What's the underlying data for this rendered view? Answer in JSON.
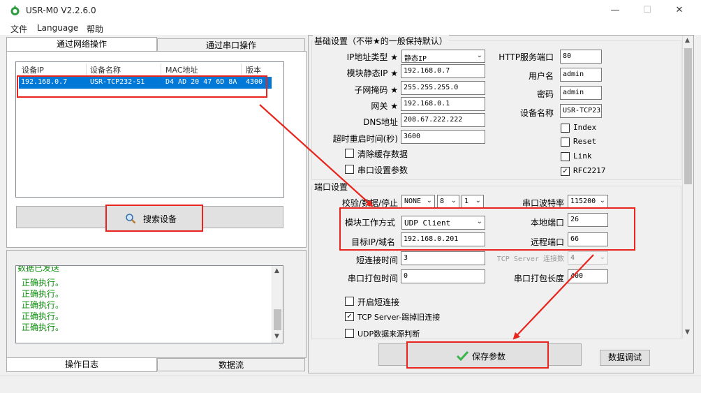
{
  "window": {
    "title": "USR-M0 V2.2.6.0",
    "minimize": "—",
    "maximize": "☐",
    "close": "✕"
  },
  "menu": [
    "文件",
    "Language",
    "帮助"
  ],
  "left": {
    "tabs": [
      "通过网络操作",
      "通过串口操作"
    ],
    "device_list": {
      "columns": [
        "设备IP",
        "设备名称",
        "MAC地址",
        "版本"
      ],
      "rows": [
        [
          "192.168.0.7",
          "USR-TCP232-S1",
          "D4 AD 20 47 6D 8A",
          "4300"
        ]
      ]
    },
    "search_button": "搜索设备",
    "log": {
      "partial_line": "数据已发送",
      "lines": [
        "正确执行。",
        "正确执行。",
        "正确执行。",
        "正确执行。",
        "正确执行。"
      ]
    },
    "bottom_tabs": [
      "操作日志",
      "数据流"
    ]
  },
  "basic": {
    "group_title": "基础设置（不带★的一般保持默认）",
    "ip_type_label": "IP地址类型 ★",
    "ip_type_value": "静态IP",
    "static_ip_label": "模块静态IP ★",
    "static_ip_value": "192.168.0.7",
    "subnet_label": "子网掩码 ★",
    "subnet_value": "255.255.255.0",
    "gateway_label": "网关 ★",
    "gateway_value": "192.168.0.1",
    "dns_label": "DNS地址",
    "dns_value": "208.67.222.222",
    "timeout_label": "超时重启时间(秒)",
    "timeout_value": "3600",
    "clear_cache_label": "清除缓存数据",
    "serial_param_label": "串口设置参数",
    "http_port_label": "HTTP服务端口",
    "http_port_value": "80",
    "username_label": "用户名",
    "username_value": "admin",
    "password_label": "密码",
    "password_value": "admin",
    "device_name_label": "设备名称",
    "device_name_value": "USR-TCP23",
    "index_label": "Index",
    "reset_label": "Reset",
    "link_label": "Link",
    "rfc_label": "RFC2217"
  },
  "port": {
    "group_title": "端口设置",
    "parity_label": "校验/数据/停止",
    "parity_value": "NONE",
    "data_bits_value": "8",
    "stop_bits_value": "1",
    "baud_label": "串口波特率",
    "baud_value": "115200",
    "mode_label": "模块工作方式",
    "mode_value": "UDP Client",
    "local_port_label": "本地端口",
    "local_port_value": "26",
    "target_ip_label": "目标IP/域名",
    "target_ip_value": "192.168.0.201",
    "remote_port_label": "远程端口",
    "remote_port_value": "66",
    "short_conn_time_label": "短连接时间",
    "short_conn_time_value": "3",
    "tcp_server_conn_label": "TCP Server 连接数",
    "tcp_server_conn_value": "4",
    "pack_time_label": "串口打包时间",
    "pack_time_value": "0",
    "pack_len_label": "串口打包长度",
    "pack_len_value": "400",
    "enable_short_label": "开启短连接",
    "tcp_kick_label": "TCP Server-踢掉旧连接",
    "udp_source_label": "UDP数据来源判断"
  },
  "save_button": "保存参数",
  "debug_button": "数据调试",
  "colors": {
    "highlight": "#e8241c",
    "selection": "#0078d7",
    "log_text": "#0a8a0a"
  }
}
